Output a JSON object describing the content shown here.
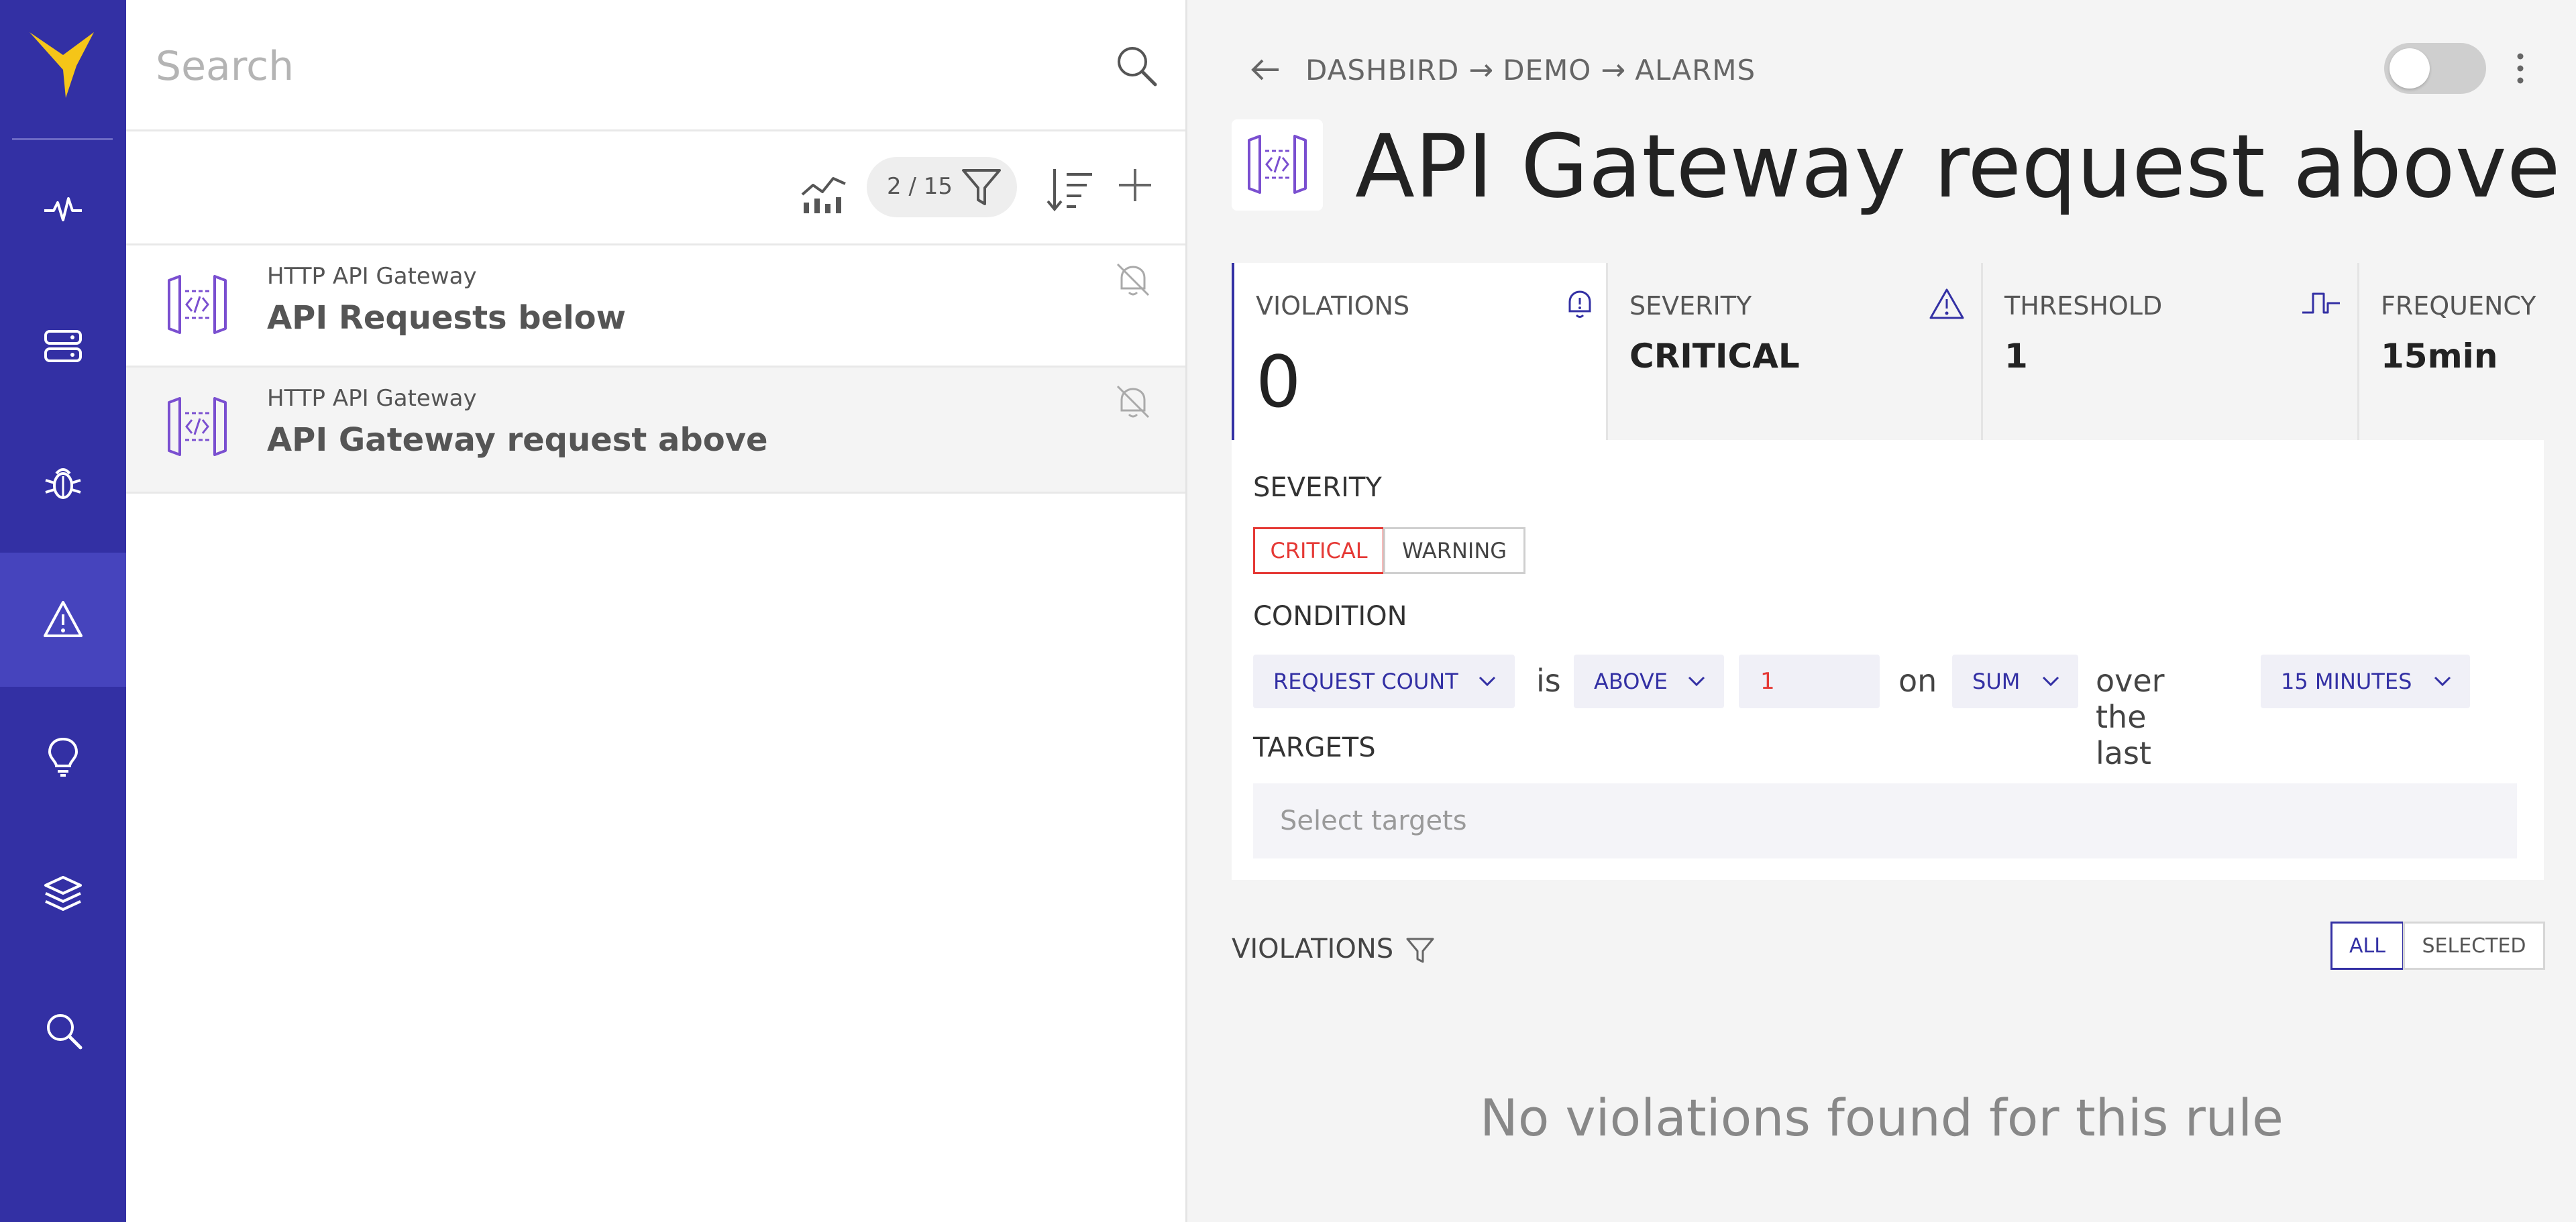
{
  "nav": {
    "items": [
      {
        "name": "activity-icon",
        "active": false
      },
      {
        "name": "resources-icon",
        "active": false
      },
      {
        "name": "bug-icon",
        "active": false
      },
      {
        "name": "alarm-icon",
        "active": true
      },
      {
        "name": "lightbulb-icon",
        "active": false
      },
      {
        "name": "layers-icon",
        "active": false
      },
      {
        "name": "search-icon",
        "active": false
      }
    ]
  },
  "list": {
    "search_placeholder": "Search",
    "count": "2 / 15",
    "items": [
      {
        "type": "HTTP API Gateway",
        "name": "API Requests below",
        "selected": false
      },
      {
        "type": "HTTP API Gateway",
        "name": "API Gateway request above",
        "selected": true
      }
    ]
  },
  "detail": {
    "breadcrumb": [
      "DASHBIRD",
      "DEMO",
      "ALARMS"
    ],
    "title": "API Gateway request above",
    "stats": [
      {
        "label": "VIOLATIONS",
        "value": "0",
        "icon": "bell-icon"
      },
      {
        "label": "SEVERITY",
        "value": "CRITICAL",
        "icon": "warning-icon"
      },
      {
        "label": "THRESHOLD",
        "value": "1",
        "icon": "threshold-icon"
      },
      {
        "label": "FREQUENCY",
        "value": "15min"
      }
    ],
    "severity": {
      "label": "SEVERITY",
      "options": [
        "CRITICAL",
        "WARNING"
      ],
      "selected": "CRITICAL"
    },
    "condition": {
      "label": "CONDITION",
      "metric": "REQUEST COUNT",
      "is": "is",
      "operator": "ABOVE",
      "value": "1",
      "on": "on",
      "aggregation": "SUM",
      "over": "over the last",
      "period": "15 MINUTES"
    },
    "targets": {
      "label": "TARGETS",
      "placeholder": "Select targets"
    },
    "violations": {
      "label": "VIOLATIONS",
      "filters": [
        "ALL",
        "SELECTED"
      ],
      "selected_filter": "ALL",
      "empty_message": "No violations found for this rule"
    },
    "colors": {
      "brand": "#3330a4",
      "critical": "#e53935",
      "logo": "#f5c518"
    }
  }
}
